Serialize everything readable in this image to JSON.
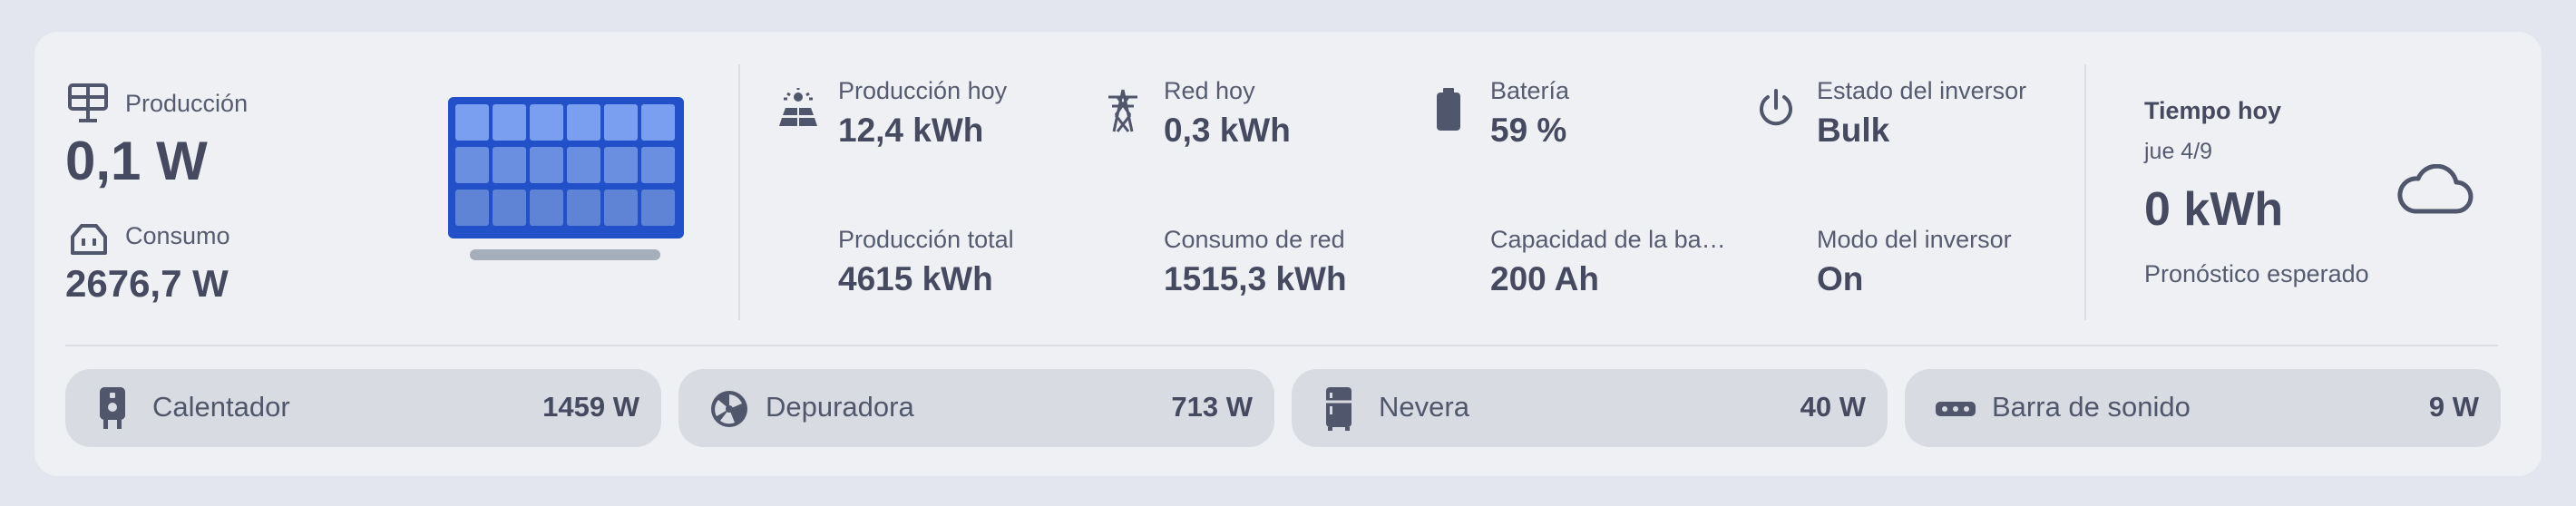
{
  "production": {
    "label": "Producción",
    "value": "0,1 W"
  },
  "consumption": {
    "label": "Consumo",
    "value": "2676,7 W"
  },
  "stats": [
    {
      "label": "Producción hoy",
      "value": "12,4 kWh",
      "icon": "solar-power-icon"
    },
    {
      "label": "Red hoy",
      "value": "0,3 kWh",
      "icon": "transmission-tower-icon"
    },
    {
      "label": "Batería",
      "value": "59 %",
      "icon": "battery-icon"
    },
    {
      "label": "Estado del inversor",
      "value": "Bulk",
      "icon": "power-icon"
    },
    {
      "label": "Producción total",
      "value": "4615 kWh"
    },
    {
      "label": "Consumo de red",
      "value": "1515,3 kWh"
    },
    {
      "label": "Capacidad de la ba…",
      "value": "200 Ah"
    },
    {
      "label": "Modo del inversor",
      "value": "On"
    }
  ],
  "weather": {
    "title": "Tiempo hoy",
    "date": "jue 4/9",
    "value": "0 kWh",
    "forecast": "Pronóstico esperado",
    "icon": "cloud-icon"
  },
  "devices": [
    {
      "name": "Calentador",
      "value": "1459 W",
      "icon": "water-heater-icon"
    },
    {
      "name": "Depuradora",
      "value": "713 W",
      "icon": "pump-icon"
    },
    {
      "name": "Nevera",
      "value": "40 W",
      "icon": "fridge-icon"
    },
    {
      "name": "Barra de sonido",
      "value": "9 W",
      "icon": "soundbar-icon"
    }
  ],
  "colors": {
    "panel_blue": "#2150c8",
    "text": "#454a61",
    "card": "#eff0f4",
    "chip": "#d8dbe2"
  }
}
